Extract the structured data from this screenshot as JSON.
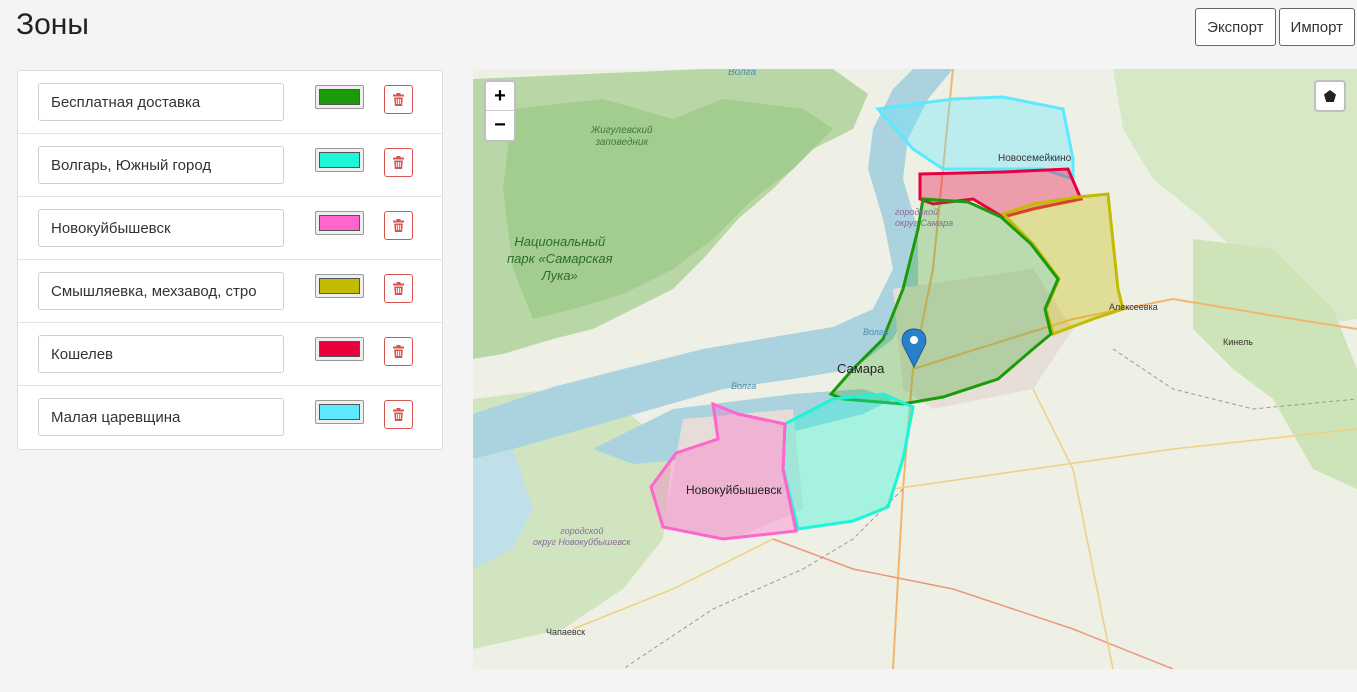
{
  "page": {
    "title": "Зоны"
  },
  "actions": {
    "export_label": "Экспорт",
    "import_label": "Импорт"
  },
  "zones": [
    {
      "name": "Бесплатная доставка",
      "color": "#1a9c0a"
    },
    {
      "name": "Волгарь, Южный город",
      "color": "#1cf5d6"
    },
    {
      "name": "Новокуйбышевск",
      "color": "#ff66cc"
    },
    {
      "name": "Смышляевка, мехзавод, стро",
      "color": "#c2bb00"
    },
    {
      "name": "Кошелев",
      "color": "#e8003d"
    },
    {
      "name": "Малая царевщина",
      "color": "#5ce8ff"
    }
  ],
  "map": {
    "zoom_in": "+",
    "zoom_out": "−",
    "labels": {
      "volga_top": "Волга",
      "zhiguli": "Жигулевский\nзаповедник",
      "park": "Национальный\nпарк «Самарская\nЛука»",
      "novosemeykino": "Новосемейкино",
      "gorod_samara": "городской\nокруг Самара",
      "alekseevka": "Алексеевка",
      "kinel": "Кинель",
      "volga_mid": "Волга",
      "samara": "Самара",
      "volga_low": "Волга",
      "novokuybyshevsk": "Новокуйбышевск",
      "gorod_novok": "городской\nокруг Новокуйбышевск",
      "chapaevsk": "Чапаевск"
    }
  }
}
